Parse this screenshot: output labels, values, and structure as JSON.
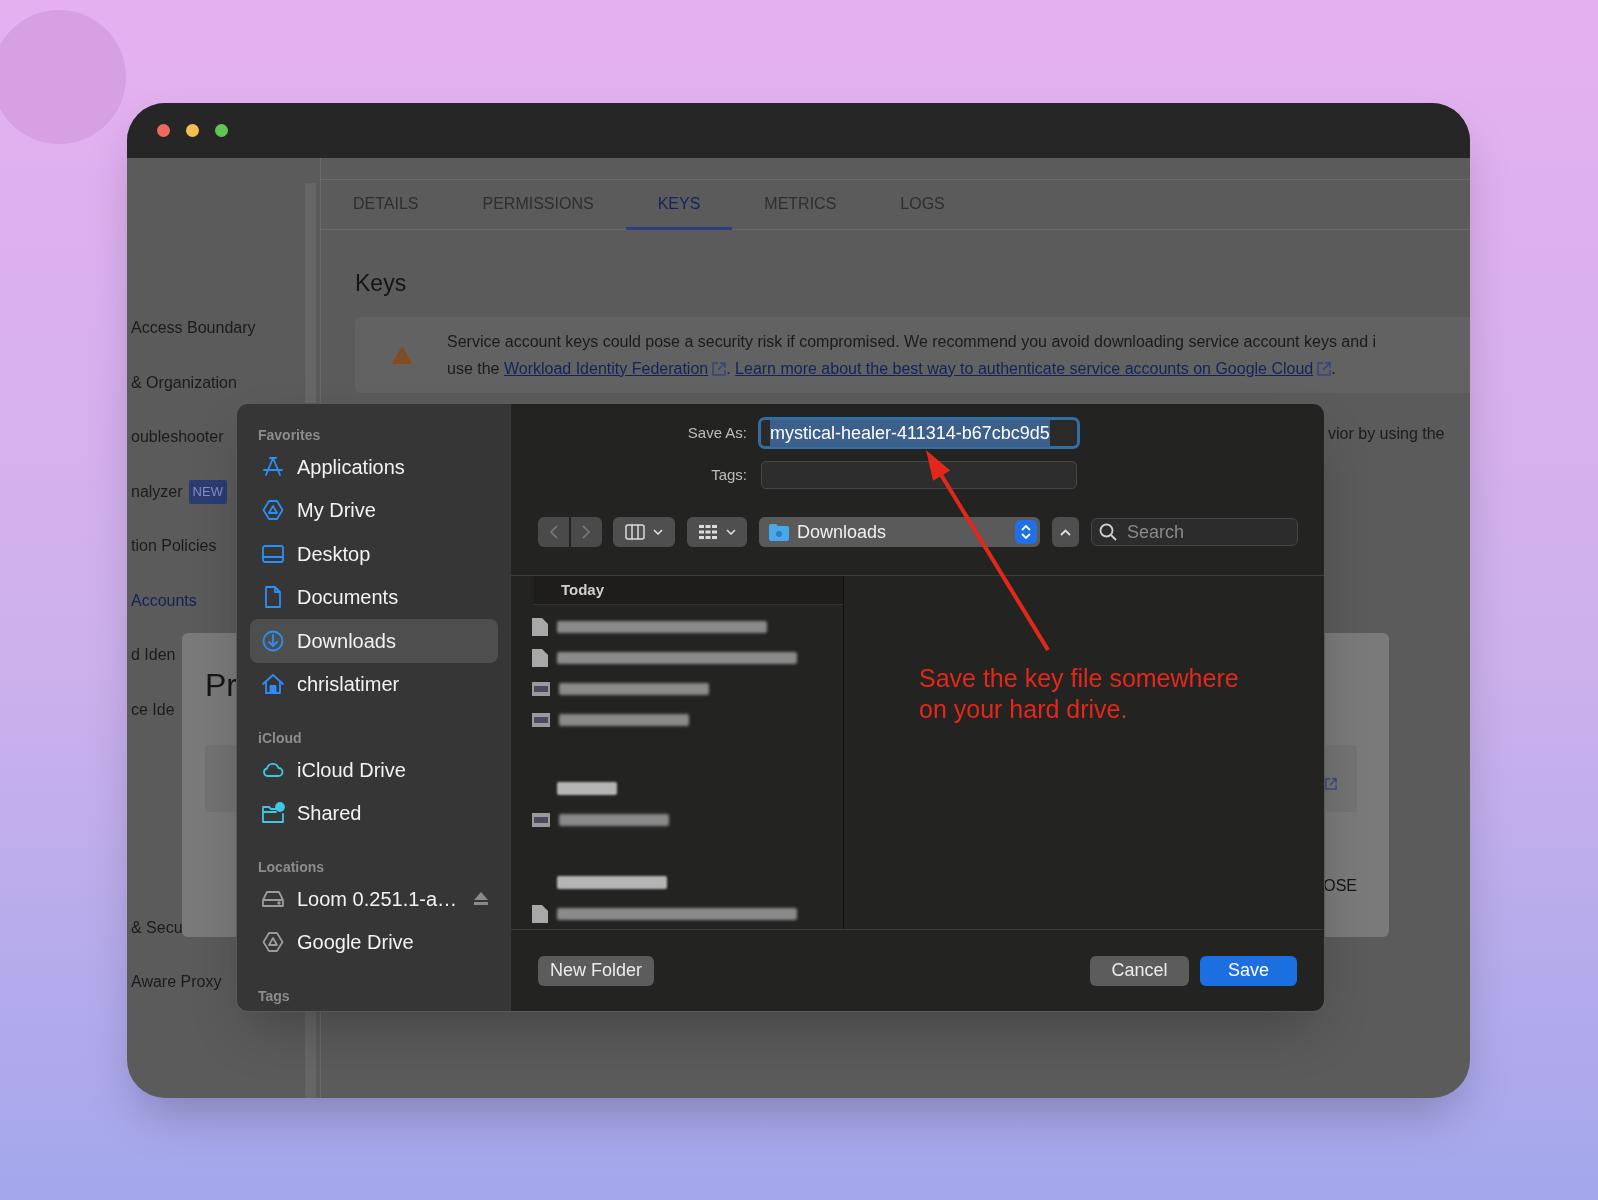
{
  "sidebar": {
    "items_top": [
      {
        "label": "Access Boundary",
        "selected": false
      },
      {
        "label": "& Organization",
        "selected": false
      },
      {
        "label": "oubleshooter",
        "selected": false
      },
      {
        "label": "nalyzer",
        "badge": "NEW",
        "selected": false
      },
      {
        "label": "tion Policies",
        "selected": false
      },
      {
        "label": "Accounts",
        "selected": true
      },
      {
        "label": "d Iden",
        "selected": false
      },
      {
        "label": "ce Ide",
        "selected": false
      }
    ],
    "items_bottom": [
      {
        "label": "& Secu",
        "selected": false
      },
      {
        "label": "Aware Proxy",
        "selected": false
      }
    ]
  },
  "tabs": [
    {
      "label": "DETAILS",
      "selected": false
    },
    {
      "label": "PERMISSIONS",
      "selected": false
    },
    {
      "label": "KEYS",
      "selected": true
    },
    {
      "label": "METRICS",
      "selected": false
    },
    {
      "label": "LOGS",
      "selected": false
    }
  ],
  "section_title": "Keys",
  "warning": {
    "parts": [
      {
        "kind": "text",
        "text": "Service account keys could pose a security risk if compromised. We recommend you avoid downloading service account keys and i"
      },
      {
        "kind": "break"
      },
      {
        "kind": "text",
        "text": "use the "
      },
      {
        "kind": "link",
        "text": "Workload Identity Federation"
      },
      {
        "kind": "text",
        "text": ". "
      },
      {
        "kind": "link",
        "text": "Learn more about the best way to authenticate service accounts on Google Cloud"
      },
      {
        "kind": "text",
        "text": "."
      }
    ]
  },
  "behind_dialog_text": "vior by using the",
  "modal": {
    "title": "Pr",
    "button": "OSE"
  },
  "save_dialog": {
    "sidebar": [
      {
        "title": "Favorites",
        "items": [
          {
            "label": "Applications",
            "selected": false
          },
          {
            "label": "My Drive",
            "selected": false
          },
          {
            "label": "Desktop",
            "selected": false
          },
          {
            "label": "Documents",
            "selected": false
          },
          {
            "label": "Downloads",
            "selected": true
          },
          {
            "label": "chrislatimer",
            "selected": false
          }
        ]
      },
      {
        "title": "iCloud",
        "items": [
          {
            "label": "iCloud Drive",
            "selected": false
          },
          {
            "label": "Shared",
            "selected": false
          }
        ]
      },
      {
        "title": "Locations",
        "items": [
          {
            "label": "Loom 0.251.1-a…",
            "ejectable": true,
            "selected": false
          },
          {
            "label": "Google Drive",
            "selected": false
          }
        ]
      },
      {
        "title": "Tags"
      }
    ],
    "save_as": {
      "label": "Save As:",
      "value": "mystical-healer-411314-b67cbc9d5",
      "text_selected": true
    },
    "tags": {
      "label": "Tags:"
    },
    "location": "Downloads",
    "search": {
      "placeholder": "Search"
    },
    "file_list": {
      "header": "Today",
      "rows": [
        {
          "kind": "file"
        },
        {
          "kind": "file"
        },
        {
          "kind": "image"
        },
        {
          "kind": "image"
        },
        {
          "kind": "group"
        },
        {
          "kind": "image"
        },
        {
          "kind": "group"
        },
        {
          "kind": "file"
        }
      ]
    },
    "buttons": [
      {
        "label": "New Folder",
        "kind": "secondary"
      },
      {
        "label": "Cancel",
        "kind": "secondary"
      },
      {
        "label": "Save",
        "kind": "primary"
      }
    ]
  },
  "annotation": {
    "text": "Save the key file somewhere on your hard drive."
  }
}
